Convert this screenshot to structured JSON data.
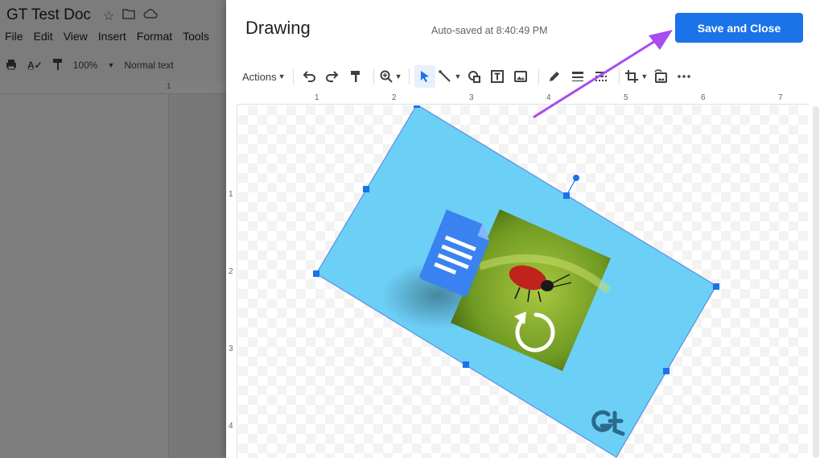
{
  "document": {
    "title": "GT Test Doc",
    "menu": [
      "File",
      "Edit",
      "View",
      "Insert",
      "Format",
      "Tools"
    ],
    "zoom": "100%",
    "style": "Normal text",
    "ruler_mark": "1"
  },
  "dialog": {
    "title": "Drawing",
    "autosave": "Auto-saved at 8:40:49 PM",
    "save_button": "Save and Close",
    "actions_label": "Actions",
    "accent_color": "#1a73e8",
    "shape_color": "#6ccff6",
    "arrow_color": "#a64cf0"
  },
  "rulers": {
    "horizontal": [
      "1",
      "2",
      "3",
      "4",
      "5",
      "6",
      "7"
    ],
    "vertical": [
      "1",
      "2",
      "3",
      "4"
    ]
  },
  "icons": {
    "star": "star-icon",
    "folder": "folder-icon",
    "cloud": "cloud-icon",
    "undo": "undo-icon",
    "redo": "redo-icon",
    "paint_format": "paint-format-icon",
    "zoom": "zoom-icon",
    "select": "select-cursor-icon",
    "line": "line-icon",
    "shape": "shape-icon",
    "text_box": "text-box-icon",
    "image": "image-icon",
    "pen": "pen-icon",
    "line_weight": "line-weight-icon",
    "line_dash": "line-dash-icon",
    "crop": "crop-icon",
    "replace_image": "replace-image-icon",
    "more": "more-icon",
    "docs_logo": "google-docs-logo",
    "rotate": "rotate-icon",
    "watermark": "gt-logo"
  }
}
